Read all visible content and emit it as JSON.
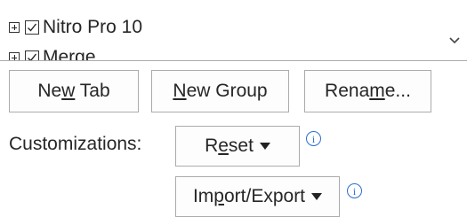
{
  "tree": {
    "items": [
      {
        "label": "Nitro Pro 10",
        "checked": true
      },
      {
        "label": "Merge",
        "checked": true
      }
    ],
    "scroll_icon": "chevron-down-icon"
  },
  "buttons": {
    "new_tab": {
      "pre": "Ne",
      "mnemonic": "w",
      "post": " Tab"
    },
    "new_group": {
      "pre": "",
      "mnemonic": "N",
      "post": "ew Group"
    },
    "rename": {
      "pre": "Rena",
      "mnemonic": "m",
      "post": "e..."
    }
  },
  "customizations": {
    "label": "Customizations:",
    "reset": {
      "pre": "R",
      "mnemonic": "e",
      "post": "set",
      "icon": "caret-down-icon"
    },
    "import_export": {
      "pre": "Im",
      "mnemonic": "p",
      "post": "ort/Export",
      "icon": "caret-down-icon"
    },
    "info_icon": "info-icon",
    "info_glyph": "i"
  },
  "colors": {
    "accent": "#2b6ed1",
    "border": "#ababab",
    "text": "#262626"
  }
}
